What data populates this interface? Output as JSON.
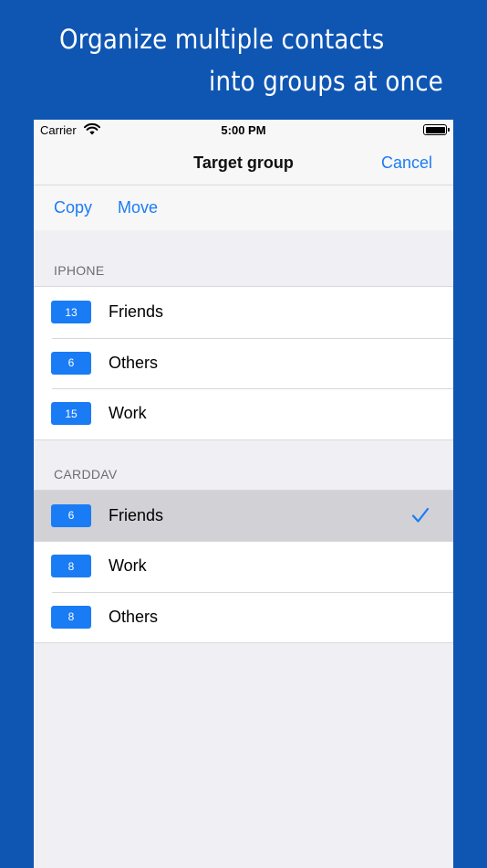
{
  "headline": {
    "line1": "Organize multiple contacts",
    "line2": "into groups at once"
  },
  "status_bar": {
    "carrier": "Carrier",
    "time": "5:00 PM"
  },
  "nav": {
    "title": "Target group",
    "cancel_label": "Cancel"
  },
  "segment": {
    "copy_label": "Copy",
    "move_label": "Move"
  },
  "sections": [
    {
      "header": "IPHONE",
      "rows": [
        {
          "count": "13",
          "label": "Friends"
        },
        {
          "count": "6",
          "label": "Others"
        },
        {
          "count": "15",
          "label": "Work"
        }
      ]
    },
    {
      "header": "CARDDAV",
      "rows": [
        {
          "count": "6",
          "label": "Friends",
          "selected": true
        },
        {
          "count": "8",
          "label": "Work"
        },
        {
          "count": "8",
          "label": "Others"
        }
      ]
    }
  ],
  "colors": {
    "background": "#0f56b3",
    "accent": "#1a7cf5",
    "selected_row": "#d1d1d6"
  }
}
